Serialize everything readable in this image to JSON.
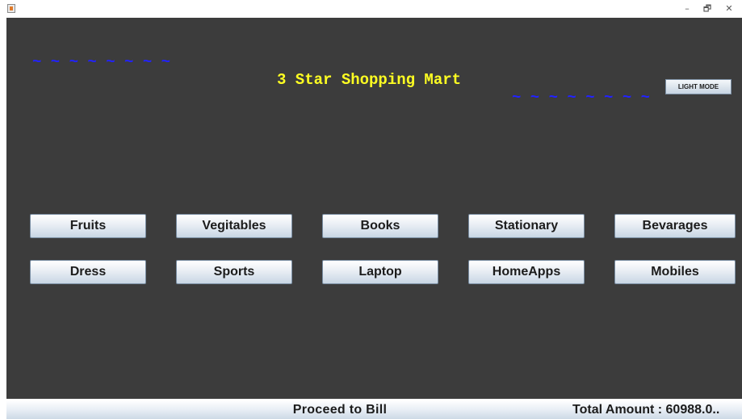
{
  "window": {
    "controls": {
      "minimize": "–",
      "restore": "🗗",
      "close": "✕"
    }
  },
  "banner": {
    "left_decoration": "~ ~ ~ ~ ~ ~ ~ ~",
    "title": "3 Star Shopping Mart",
    "right_decoration": "~ ~ ~ ~ ~ ~ ~ ~",
    "decoration_color": "#2222ff",
    "title_color": "#ffff22"
  },
  "theme_toggle": {
    "label": "LIGHT MODE"
  },
  "categories": {
    "row1": [
      "Fruits",
      "Vegitables",
      "Books",
      "Stationary",
      "Bevarages"
    ],
    "row2": [
      "Dress",
      "Sports",
      "Laptop",
      "HomeApps",
      "Mobiles"
    ]
  },
  "footer": {
    "bill_label": "Proceed  to  Bill",
    "total_label": "Total Amount : 60988.0.."
  },
  "colors": {
    "panel_bg": "#3c3c3c"
  }
}
